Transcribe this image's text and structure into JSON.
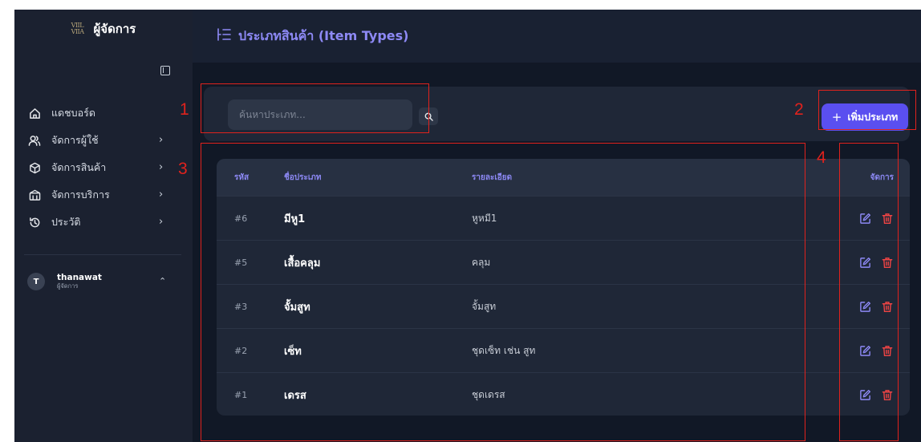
{
  "sidebar": {
    "brand_logo": "VIIL VIIA",
    "brand_title": "ผู้จัดการ",
    "items": [
      {
        "label": "แดชบอร์ด",
        "icon": "home-icon",
        "has_chevron": false
      },
      {
        "label": "จัดการผู้ใช้",
        "icon": "users-icon",
        "has_chevron": true
      },
      {
        "label": "จัดการสินค้า",
        "icon": "box-icon",
        "has_chevron": true
      },
      {
        "label": "จัดการบริการ",
        "icon": "service-icon",
        "has_chevron": true
      },
      {
        "label": "ประวัติ",
        "icon": "history-icon",
        "has_chevron": true
      }
    ],
    "user": {
      "initial": "T",
      "name": "thanawat",
      "role": "ผู้จัดการ"
    }
  },
  "header": {
    "title": "ประเภทสินค้า (Item Types)",
    "icon": "list-icon"
  },
  "search": {
    "placeholder": "ค้นหาประเภท..."
  },
  "add_button": {
    "label": "เพิ่มประเภท"
  },
  "table": {
    "columns": {
      "id": "รหัส",
      "name": "ชื่อประเภท",
      "description": "รายละเอียด",
      "actions": "จัดการ"
    },
    "rows": [
      {
        "id": "#6",
        "name": "มีหู1",
        "description": "หูหมี1"
      },
      {
        "id": "#5",
        "name": "เสื้อคลุม",
        "description": "คลุม"
      },
      {
        "id": "#3",
        "name": "จั้มสูท",
        "description": "จั้มสูท"
      },
      {
        "id": "#2",
        "name": "เซ็ท",
        "description": "ชุดเซ็ท เช่น สูท"
      },
      {
        "id": "#1",
        "name": "เดรส",
        "description": "ชุดเดรส"
      }
    ]
  },
  "annotations": {
    "labels": [
      "1",
      "2",
      "3",
      "4"
    ],
    "color": "#e0221d"
  },
  "colors": {
    "accent": "#5a4ff0",
    "accent_text": "#8d89f5",
    "edit": "#8d89f5",
    "delete": "#ef4444",
    "background": "#111826",
    "sidebar": "#1b2130",
    "card": "#1f2737"
  }
}
